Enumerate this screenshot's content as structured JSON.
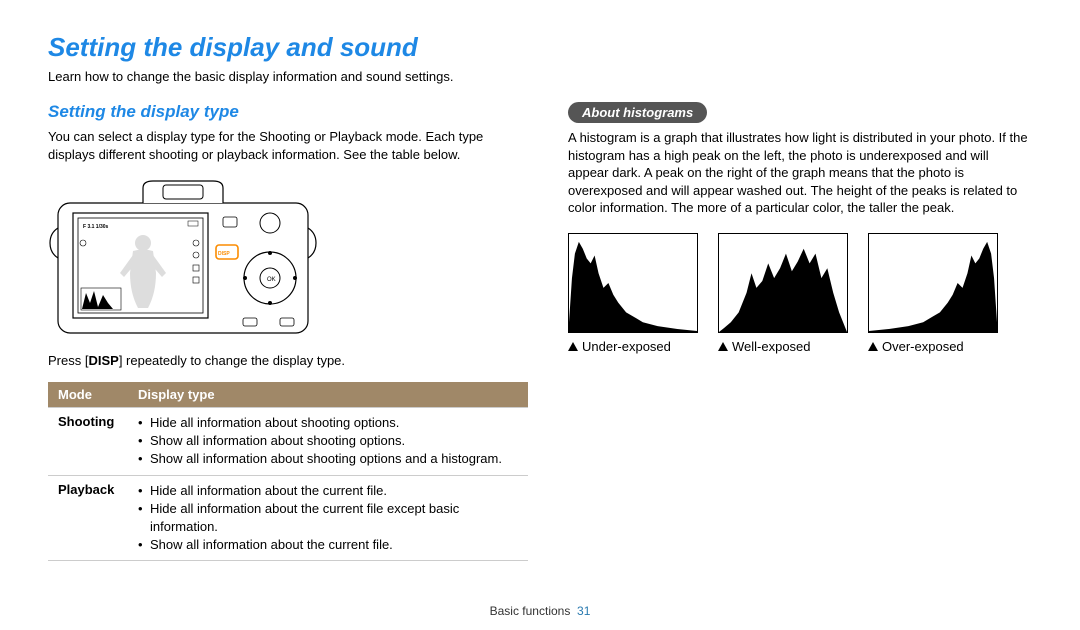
{
  "header": {
    "title": "Setting the display and sound",
    "subtitle": "Learn how to change the basic display information and sound settings."
  },
  "left": {
    "section_title": "Setting the display type",
    "intro": "You can select a display type for the Shooting or Playback mode. Each type displays different shooting or playback information. See the table below.",
    "instruction_pre": "Press [",
    "instruction_key": "DISP",
    "instruction_post": "] repeatedly to change the display type.",
    "lcd_status": "F 3.1  1/30s",
    "disp_button": "DISP",
    "table": {
      "head_mode": "Mode",
      "head_type": "Display type",
      "rows": [
        {
          "mode": "Shooting",
          "items": [
            "Hide all information about shooting options.",
            "Show all information about shooting options.",
            "Show all information about shooting options and a histogram."
          ]
        },
        {
          "mode": "Playback",
          "items": [
            "Hide all information about the current file.",
            "Hide all information about the current file except basic information.",
            "Show all information about the current file."
          ]
        }
      ]
    }
  },
  "right": {
    "pill": "About histograms",
    "body": "A histogram is a graph that illustrates how light is distributed in your photo. If the histogram has a high peak on the left, the photo is underexposed and will appear dark. A peak on the right of the graph means that the photo is overexposed and will appear washed out. The height of the peaks is related to color information. The more of a particular color, the taller the peak.",
    "histograms": [
      {
        "caption": "Under-exposed"
      },
      {
        "caption": "Well-exposed"
      },
      {
        "caption": "Over-exposed"
      }
    ]
  },
  "footer": {
    "section": "Basic functions",
    "page": "31"
  }
}
